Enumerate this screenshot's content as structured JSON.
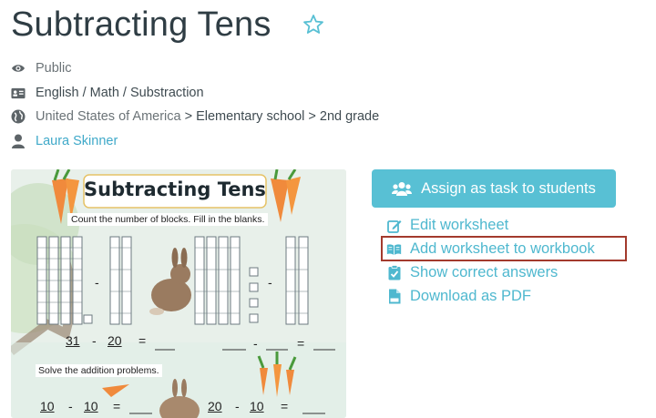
{
  "page": {
    "title": "Subtracting Tens",
    "visibility": "Public",
    "subject": "English / Math / Substraction",
    "location_country": "United States of America",
    "location_path": "> Elementary school > 2nd grade",
    "author": "Laura Skinner"
  },
  "worksheet": {
    "heading": "Subtracting Tens",
    "instruction1": "Count the number of blocks. Fill in the blanks.",
    "eq1_a": "31",
    "eq1_op": "-",
    "eq1_b": "20",
    "eq1_eq": "=",
    "mid_op": "-",
    "eq2_op": "-",
    "eq2_eq": "=",
    "instruction2": "Solve the addition problems.",
    "eq3_a": "10",
    "eq3_op": "-",
    "eq3_b": "10",
    "eq3_eq": "=",
    "eq4_a": "20",
    "eq4_op": "-",
    "eq4_b": "10",
    "eq4_eq": "="
  },
  "actions": {
    "assign": "Assign as task to students",
    "edit": "Edit worksheet",
    "add_workbook": "Add worksheet to workbook",
    "show_answers": "Show correct answers",
    "download": "Download as PDF"
  },
  "colors": {
    "accent": "#58c0d4",
    "link": "#4fb8cf",
    "highlight": "#a33a2d"
  }
}
